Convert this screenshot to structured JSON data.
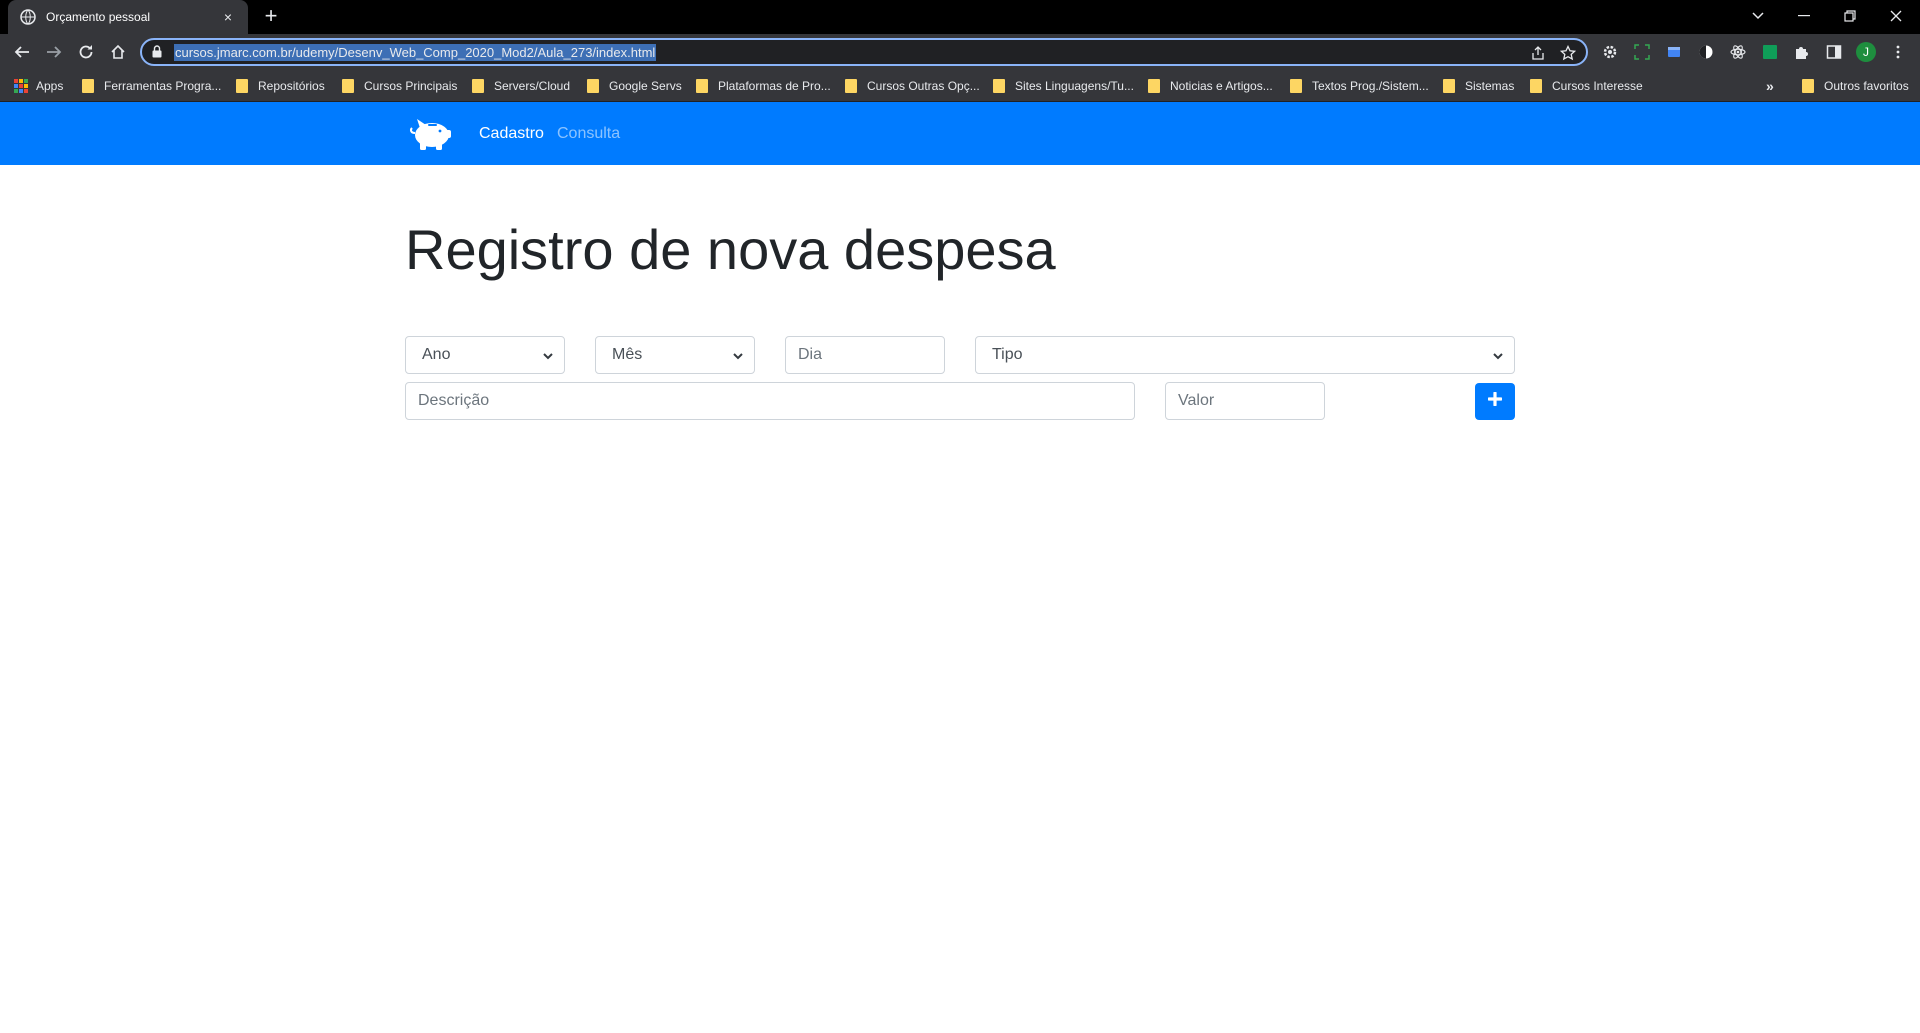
{
  "browser": {
    "tab_title": "Orçamento pessoal",
    "tab_close": "×",
    "new_tab": "+",
    "url": "cursos.jmarc.com.br/udemy/Desenv_Web_Comp_2020_Mod2/Aula_273/index.html",
    "profile_initial": "J",
    "bookmarks_overflow": "»",
    "bookmarks": [
      "Apps",
      "Ferramentas Progra...",
      "Repositórios",
      "Cursos Principais",
      "Servers/Cloud",
      "Google Servs",
      "Plataformas de Pro...",
      "Cursos Outras Opç...",
      "Sites Linguagens/Tu...",
      "Noticias e Artigos...",
      "Textos Prog./Sistem...",
      "Sistemas",
      "Cursos Interesse"
    ],
    "other_bookmarks": "Outros favoritos"
  },
  "colors": {
    "navbar": "#007bff",
    "primary_button": "#007bff",
    "title_text": "#212529",
    "placeholder_text": "#6c757d",
    "field_border": "#ced4da"
  },
  "navbar": {
    "brand_icon": "piggy-bank-icon",
    "links": [
      "Cadastro",
      "Consulta"
    ],
    "active_link": "Cadastro"
  },
  "form": {
    "title": "Registro de nova despesa",
    "ano_label": "Ano",
    "mes_label": "Mês",
    "dia_placeholder": "Dia",
    "tipo_label": "Tipo",
    "descricao_placeholder": "Descrição",
    "valor_placeholder": "Valor",
    "add_button_icon": "plus-icon"
  }
}
